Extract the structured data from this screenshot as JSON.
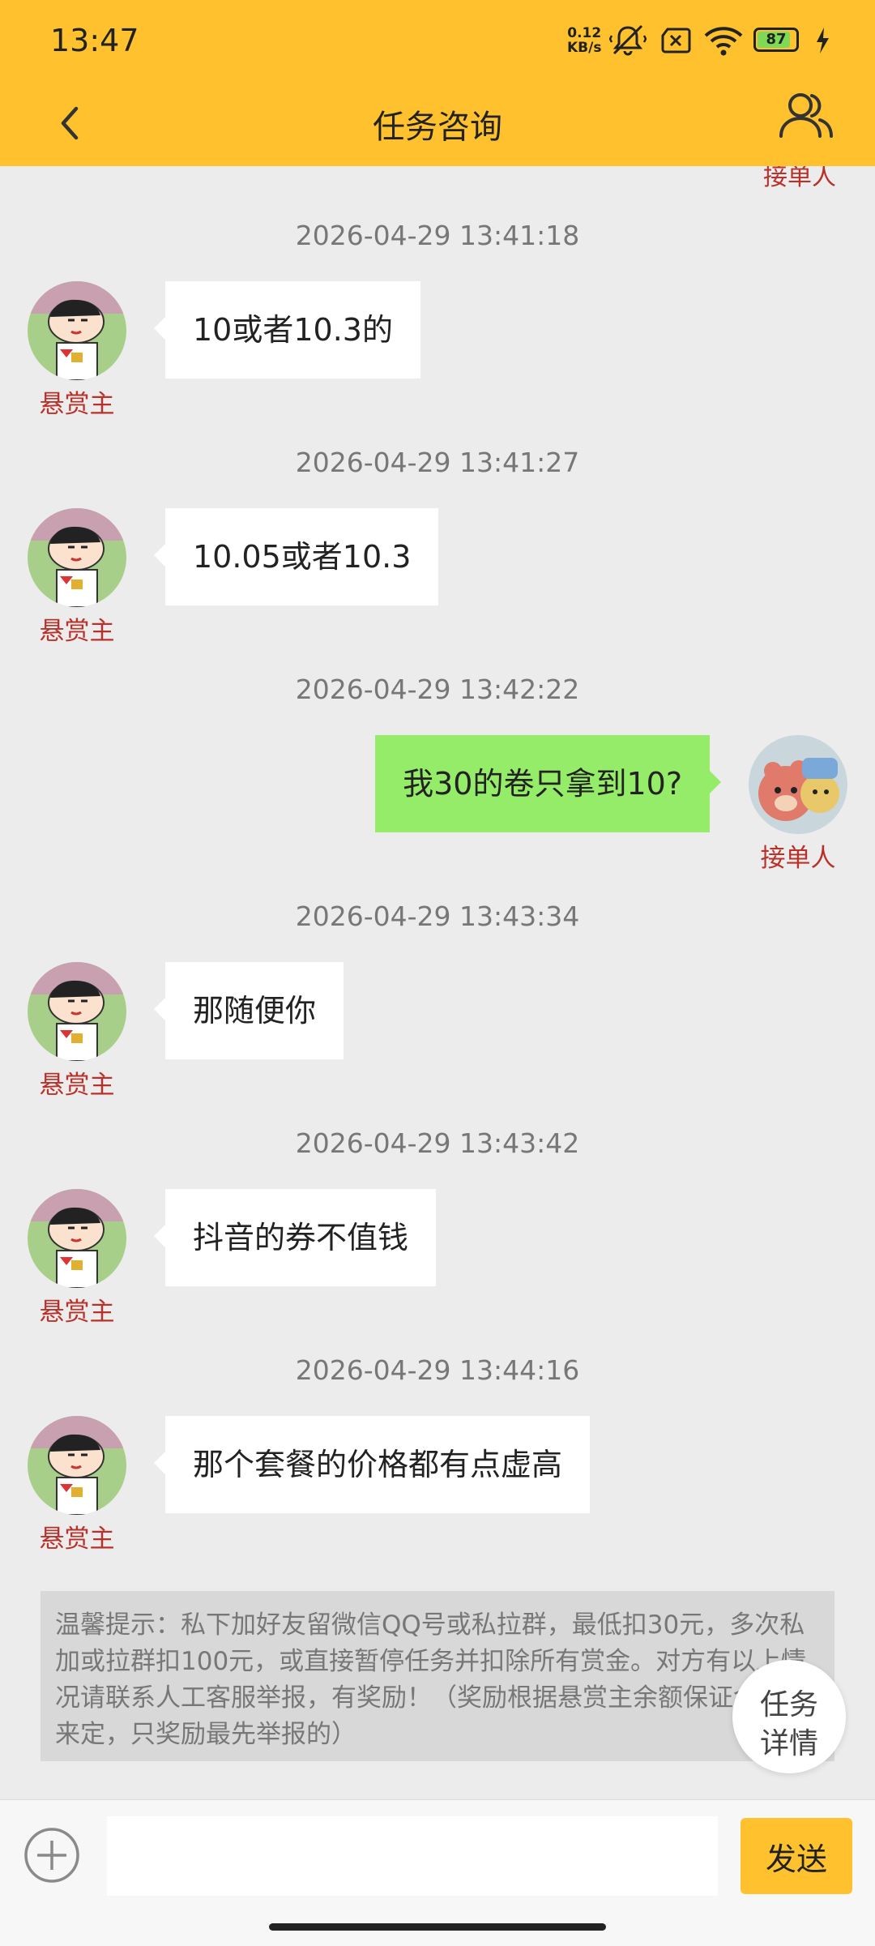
{
  "status_bar": {
    "time": "13:47",
    "net_speed_value": "0.12",
    "net_speed_unit": "KB/s",
    "battery_level": "87",
    "icons": [
      "mute-vibrate-icon",
      "sim-off-icon",
      "wifi-icon",
      "battery-icon",
      "charging-icon"
    ]
  },
  "header": {
    "title": "任务咨询",
    "back_icon": "chevron-left-icon",
    "people_icon": "people-icon"
  },
  "colors": {
    "header": "#ffc22e",
    "sent_bubble": "#95ec69",
    "role_label": "#b8322b",
    "background": "#ececec"
  },
  "chat": {
    "top_partial_label": "接单人",
    "messages": [
      {
        "time": "2026-04-29 13:41:18",
        "text": "10或者10.3的",
        "role": "悬赏主",
        "side": "left"
      },
      {
        "time": "2026-04-29 13:41:27",
        "text": "10.05或者10.3",
        "role": "悬赏主",
        "side": "left"
      },
      {
        "time": "2026-04-29 13:42:22",
        "text": "我30的卷只拿到10?",
        "role": "接单人",
        "side": "right"
      },
      {
        "time": "2026-04-29 13:43:34",
        "text": "那随便你",
        "role": "悬赏主",
        "side": "left"
      },
      {
        "time": "2026-04-29 13:43:42",
        "text": "抖音的券不值钱",
        "role": "悬赏主",
        "side": "left"
      },
      {
        "time": "2026-04-29 13:44:16",
        "text": "那个套餐的价格都有点虚高",
        "role": "悬赏主",
        "side": "left"
      }
    ]
  },
  "notice": {
    "text": "温馨提示：私下加好友留微信QQ号或私拉群，最低扣30元，多次私加或拉群扣100元，或直接暂停任务并扣除所有赏金。对方有以上情况请联系人工客服举报，有奖励！（奖励根据悬赏主余额保证金多少来定，只奖励最先举报的）"
  },
  "task_button": {
    "line1": "任务",
    "line2": "详情"
  },
  "input_bar": {
    "plus_icon": "add-circle-icon",
    "placeholder": "",
    "send_label": "发送"
  }
}
